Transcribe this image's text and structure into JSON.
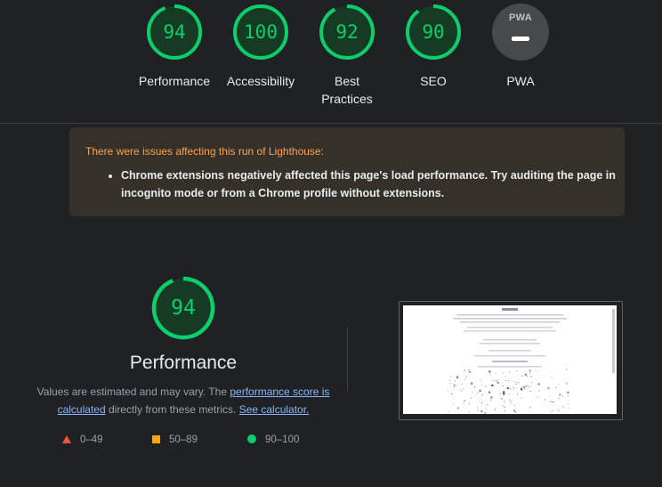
{
  "gauges": [
    {
      "score": "94",
      "label": "Performance"
    },
    {
      "score": "100",
      "label": "Accessibility"
    },
    {
      "score": "92",
      "label": "Best Practices"
    },
    {
      "score": "90",
      "label": "SEO"
    }
  ],
  "pwa": {
    "badge": "PWA",
    "label": "PWA"
  },
  "warning": {
    "title": "There were issues affecting this run of Lighthouse:",
    "items": [
      "Chrome extensions negatively affected this page's load performance. Try auditing the page in incognito mode or from a Chrome profile without extensions."
    ]
  },
  "performance": {
    "score": "94",
    "score_fraction": 0.94,
    "title": "Performance",
    "desc_before": "Values are estimated and may vary. The ",
    "link_score": "performance score is calculated",
    "desc_middle": " directly from these metrics. ",
    "link_calc": "See calculator."
  },
  "legend": [
    {
      "icon": "triangle",
      "range": "0–49",
      "color": "#ff4e42"
    },
    {
      "icon": "square",
      "range": "50–89",
      "color": "#ffa400"
    },
    {
      "icon": "circle",
      "range": "90–100",
      "color": "#0cce6b"
    }
  ],
  "gauge_fractions": [
    0.94,
    1.0,
    0.92,
    0.9
  ],
  "colors": {
    "pass": "#0cce6b",
    "pass_track": "#153b25",
    "warning_title": "#ffa445",
    "link": "#8ab4f8"
  }
}
